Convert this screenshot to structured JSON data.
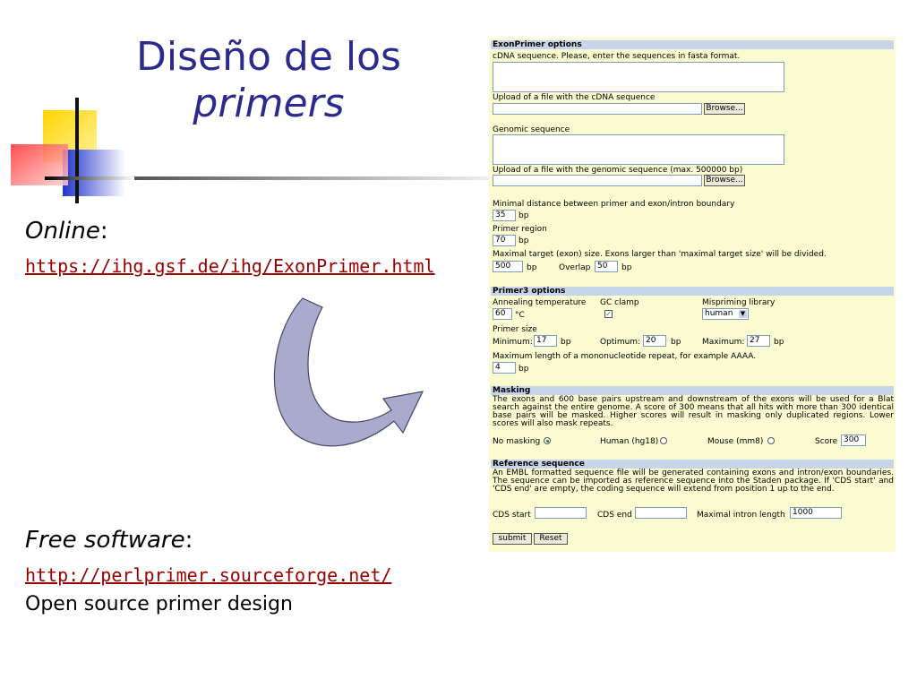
{
  "slide": {
    "title_line1": "Diseño de los",
    "title_line2": "primers",
    "online_label": "Online",
    "online_colon": ":",
    "online_url": "https://ihg.gsf.de/ihg/ExonPrimer.html",
    "free_label": "Free software",
    "free_colon": ":",
    "free_url": "http://perlprimer.sourceforge.net/",
    "free_desc": "Open source primer design"
  },
  "form": {
    "exonprimer_header": "ExonPrimer options",
    "cdna_label": "cDNA sequence. Please, enter the sequences in fasta format.",
    "cdna_upload_label": "Upload of a file with the cDNA sequence",
    "browse_label": "Browse...",
    "genomic_label": "Genomic sequence",
    "genomic_upload_label": "Upload of a file with the genomic sequence (max. 500000 bp)",
    "min_dist_label": "Minimal distance between primer and exon/intron boundary",
    "min_dist_value": "35",
    "bp": "bp",
    "primer_region_label": "Primer region",
    "primer_region_value": "70",
    "max_target_label": "Maximal target (exon) size. Exons larger than 'maximal target size' will be divided.",
    "max_target_value": "500",
    "overlap_label": "Overlap",
    "overlap_value": "50",
    "primer3_header": "Primer3 options",
    "annealing_label": "Annealing temperature",
    "annealing_value": "60",
    "celsius": "°C",
    "gc_clamp_label": "GC clamp",
    "mispriming_label": "Mispriming library",
    "mispriming_value": "human",
    "primer_size_label": "Primer size",
    "minimum_label": "Minimum:",
    "minimum_value": "17",
    "optimum_label": "Optimum:",
    "optimum_value": "20",
    "maximum_label": "Maximum:",
    "maximum_value": "27",
    "mono_label": "Maximum length of a mononucleotide repeat, for example AAAA.",
    "mono_value": "4",
    "masking_header": "Masking",
    "masking_text": "The exons and 600 base pairs upstream and downstream of the exons will be used for a Blat search against the entire genome. A score of 300 means that all hits with more than 300 identical base pairs will be masked. Higher scores will result in masking only duplicated regions. Lower scores will also mask repeats.",
    "no_masking_label": "No masking",
    "human_label": "Human (hg18)",
    "mouse_label": "Mouse (mm8)",
    "score_label": "Score",
    "score_value": "300",
    "reference_header": "Reference sequence",
    "reference_text": "An EMBL formatted sequence file will be generated containing exons and intron/exon boundaries. The sequence can be imported as reference sequence into the Staden package. If 'CDS start' and 'CDS end' are empty, the coding sequence will extend from position 1 up to the end.",
    "cds_start_label": "CDS start",
    "cds_end_label": "CDS end",
    "max_intron_label": "Maximal intron length",
    "max_intron_value": "1000",
    "submit_label": "submit",
    "reset_label": "Reset"
  }
}
